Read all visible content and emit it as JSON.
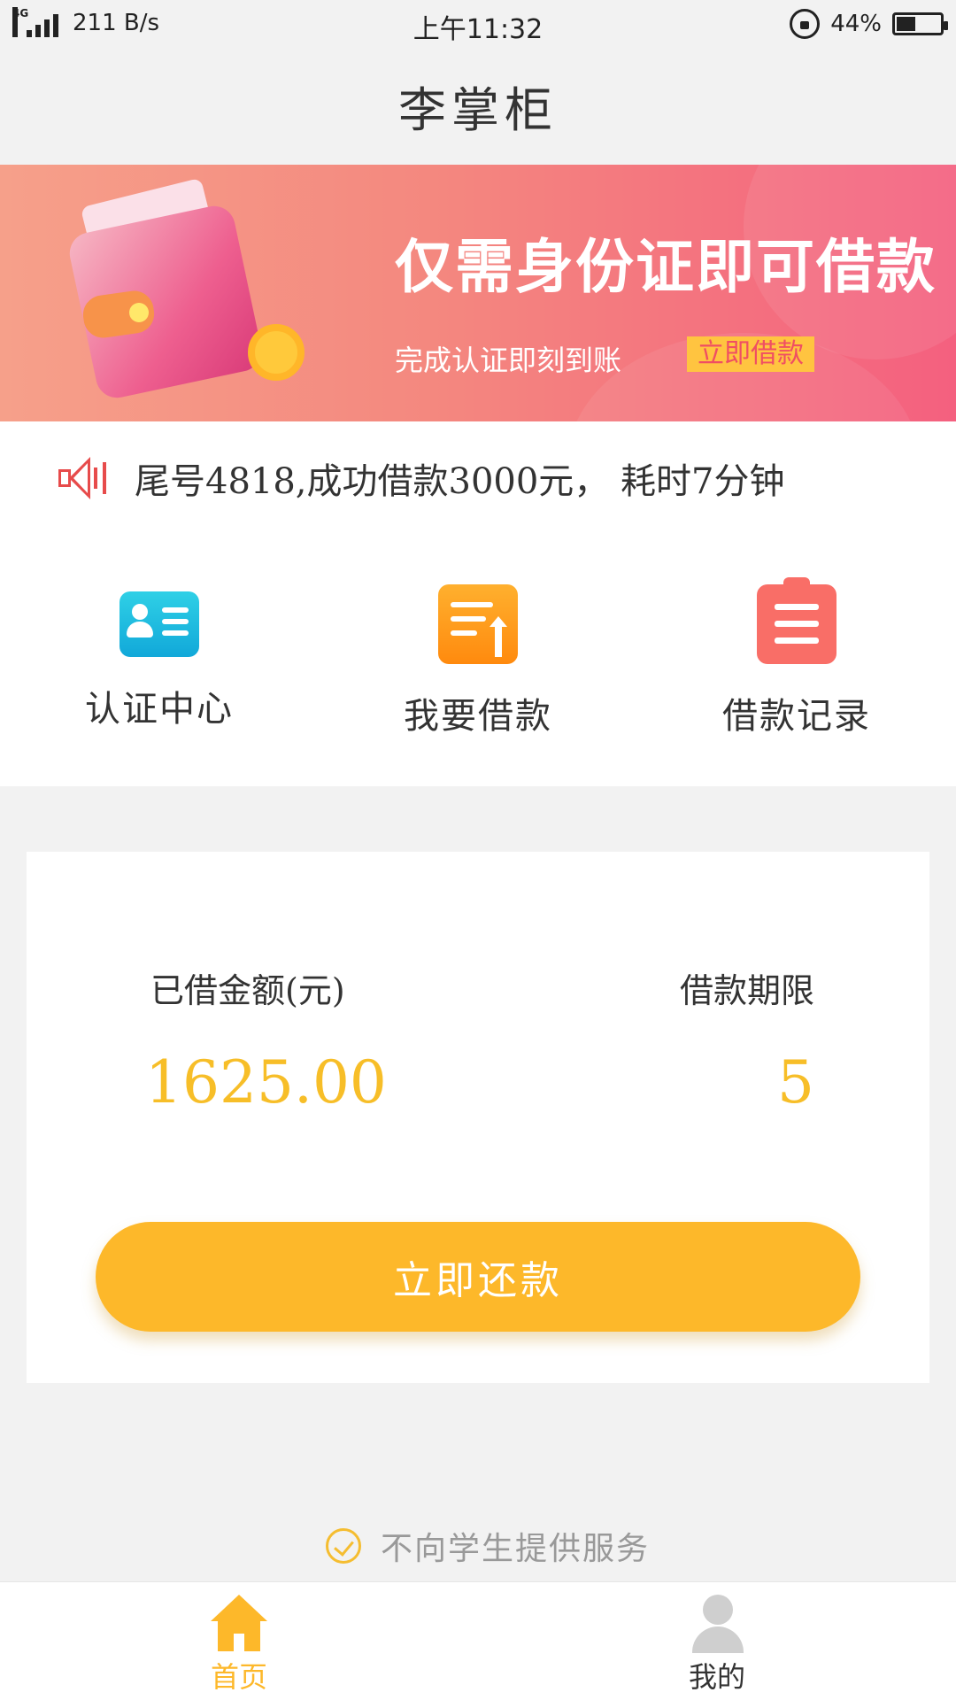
{
  "status_bar": {
    "network": "4G",
    "speed": "211 B/s",
    "time": "上午11:32",
    "battery_percent": "44%",
    "battery_level": 0.44
  },
  "header": {
    "title": "李掌柜"
  },
  "banner": {
    "headline": "仅需身份证即可借款",
    "subtitle": "完成认证即刻到账",
    "cta": "立即借款"
  },
  "notice": {
    "text": "尾号4818,成功借款3000元， 耗时7分钟"
  },
  "quick_actions": [
    {
      "label": "认证中心",
      "icon": "id-card-icon"
    },
    {
      "label": "我要借款",
      "icon": "loan-request-icon"
    },
    {
      "label": "借款记录",
      "icon": "loan-records-icon"
    }
  ],
  "loan_card": {
    "amount_label": "已借金额(元)",
    "amount_value": "1625.00",
    "term_label": "借款期限",
    "term_value": "5",
    "repay_button": "立即还款"
  },
  "footnote": {
    "text": "不向学生提供服务"
  },
  "tabbar": {
    "home_label": "首页",
    "me_label": "我的"
  },
  "colors": {
    "accent": "#fdb82a",
    "amount": "#f7be28",
    "banner_start": "#f6a08a",
    "banner_end": "#f4607f"
  }
}
